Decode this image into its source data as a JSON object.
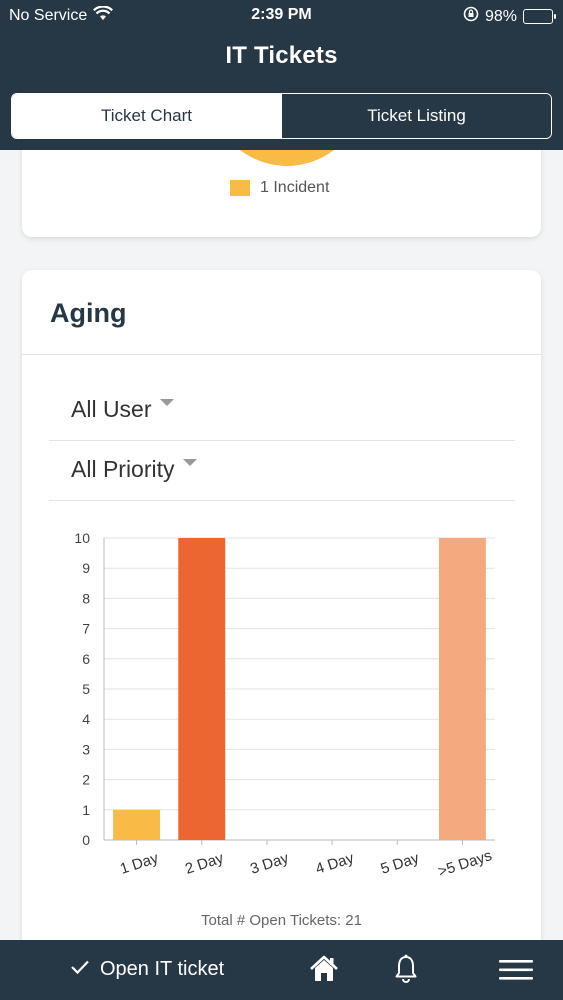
{
  "status_bar": {
    "carrier": "No Service",
    "time": "2:39 PM",
    "battery": "98%"
  },
  "header": {
    "title": "IT Tickets",
    "tabs": [
      {
        "label": "Ticket Chart",
        "active": true
      },
      {
        "label": "Ticket Listing",
        "active": false
      }
    ]
  },
  "incident_card": {
    "legend_label": "1 Incident",
    "legend_color": "#f8bb46"
  },
  "aging": {
    "title": "Aging",
    "user_filter": "All User",
    "priority_filter": "All Priority",
    "total_text": "Total # Open Tickets: 21"
  },
  "chart_data": {
    "type": "bar",
    "title": "",
    "xlabel": "",
    "ylabel": "",
    "categories": [
      "1 Day",
      "2 Day",
      "3 Day",
      "4 Day",
      "5 Day",
      ">5 Days"
    ],
    "values": [
      1,
      10,
      0,
      0,
      0,
      10
    ],
    "colors": [
      "#f8bb46",
      "#eb6631",
      "#eb6631",
      "#eb6631",
      "#eb6631",
      "#f5a97f"
    ],
    "ylim": [
      0,
      10
    ],
    "yticks": [
      0,
      1,
      2,
      3,
      4,
      5,
      6,
      7,
      8,
      9,
      10
    ],
    "grid": true
  },
  "bottom_bar": {
    "open_ticket_label": "Open IT ticket"
  },
  "colors": {
    "navy": "#263745",
    "accent_yellow": "#f8bb46",
    "accent_orange": "#eb6631",
    "accent_peach": "#f5a97f"
  }
}
